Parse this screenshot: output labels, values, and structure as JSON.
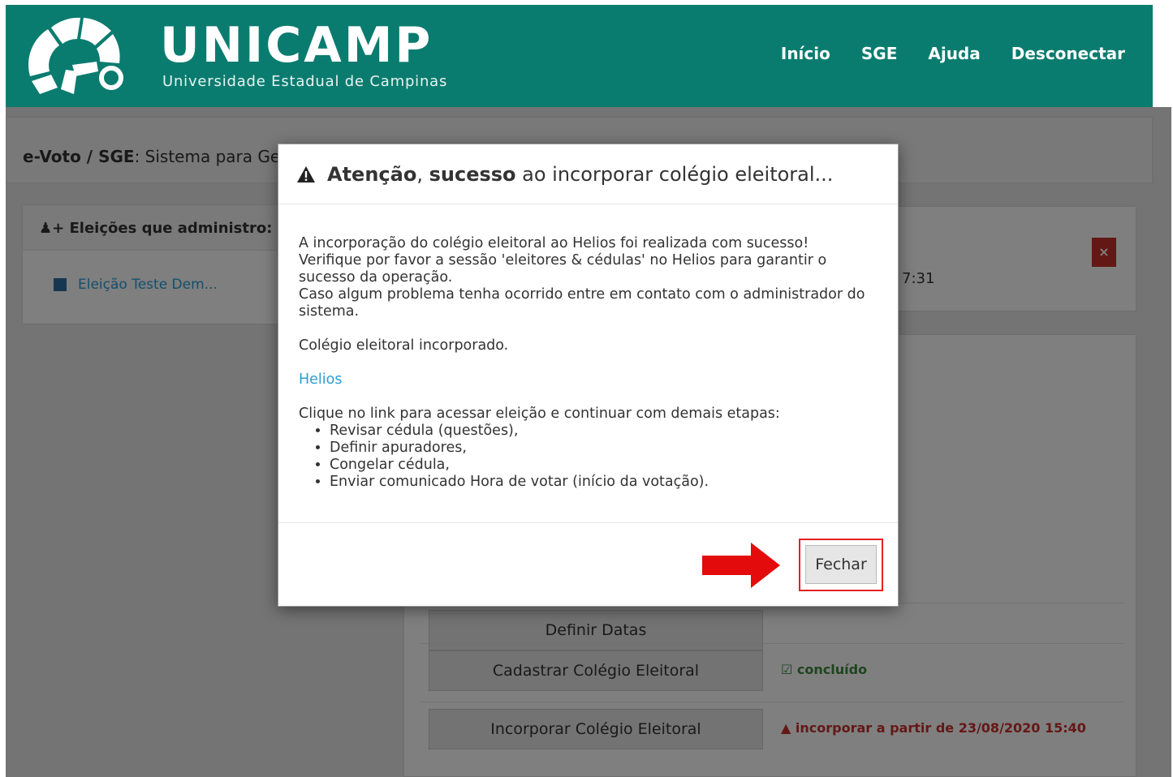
{
  "header": {
    "brand_name": "UNICAMP",
    "brand_sub": "Universidade Estadual de Campinas",
    "nav": [
      "Início",
      "SGE",
      "Ajuda",
      "Desconectar"
    ],
    "color": "#0a7c6f"
  },
  "page": {
    "breadcrumb_bold": "e-Voto / SGE",
    "breadcrumb_text": ": Sistema para Gestão de Eleições e Consultas da Unicamp",
    "left_panel_title": "Eleições que administro:",
    "left_panel_item": "Eleição Teste Dem...",
    "time_fragment": "7:31",
    "close_label": "×",
    "steps": [
      {
        "label": "Definir Datas",
        "status": "",
        "status_type": "ok"
      },
      {
        "label": "Cadastrar Colégio Eleitoral",
        "status": "concluído",
        "status_type": "ok"
      },
      {
        "label": "Incorporar Colégio Eleitoral",
        "status": "incorporar a partir de 23/08/2020 15:40",
        "status_type": "warn"
      }
    ]
  },
  "modal": {
    "title_bold1": "Atenção",
    "title_sep": ", ",
    "title_bold2": "sucesso",
    "title_rest": " ao incorporar colégio eleitoral...",
    "body_lines": [
      "A incorporação do colégio eleitoral ao Helios foi realizada com sucesso!",
      "Verifique por favor a sessão 'eleitores & cédulas' no Helios para garantir o sucesso da operação.",
      "Caso algum problema tenha ocorrido entre em contato com o administrador do sistema."
    ],
    "incorporated": "Colégio eleitoral incorporado.",
    "link_text": "Helios",
    "instructions": "Clique no link para acessar eleição e continuar com demais etapas:",
    "steps": [
      "Revisar cédula (questões),",
      "Definir apuradores,",
      "Congelar cédula,",
      "Enviar comunicado Hora de votar (início da votação)."
    ],
    "close_button": "Fechar",
    "arrow_color": "#e30b0b",
    "highlight_color": "#e32222"
  }
}
